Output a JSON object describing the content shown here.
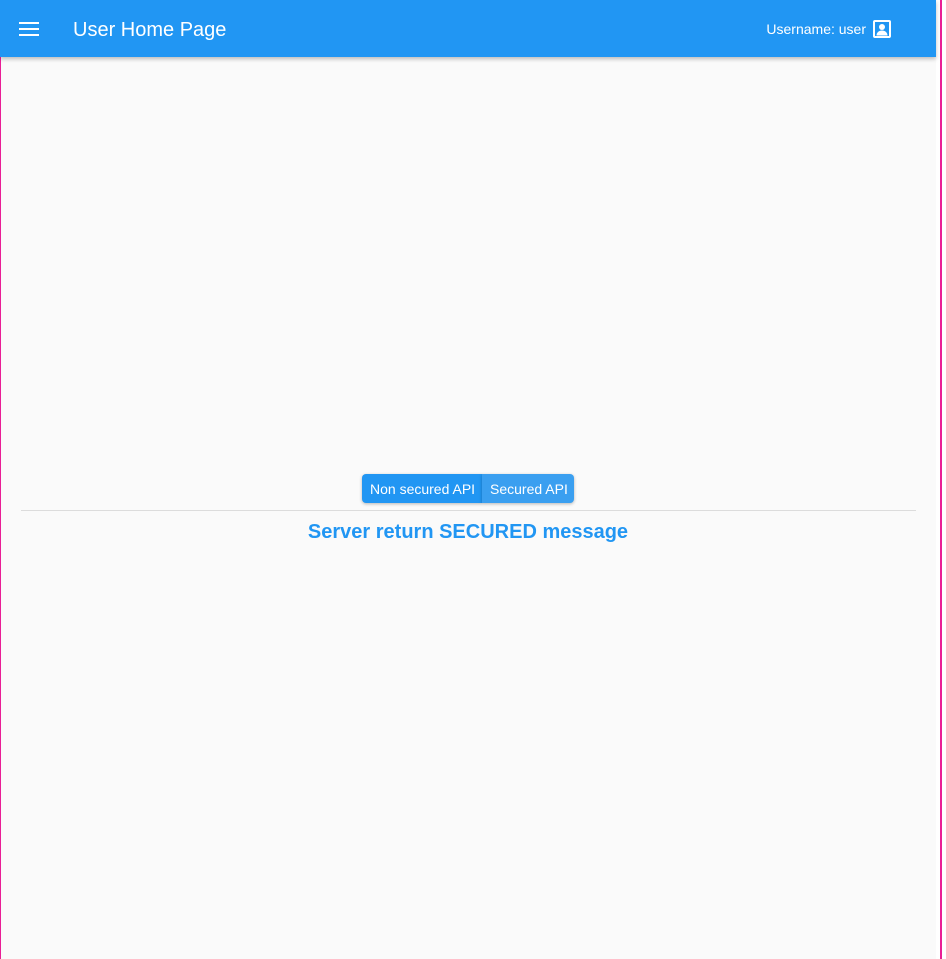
{
  "app_bar": {
    "title": "User Home Page",
    "menu_icon": "menu-icon",
    "username_text": "Username: user",
    "account_icon": "account-box-icon",
    "background_color": "#2196f3",
    "text_color": "#ffffff"
  },
  "main": {
    "buttons": [
      {
        "label": "Non secured API"
      },
      {
        "label": "Secured API"
      }
    ],
    "message": "Server return SECURED message",
    "accent_color": "#2196f3"
  }
}
